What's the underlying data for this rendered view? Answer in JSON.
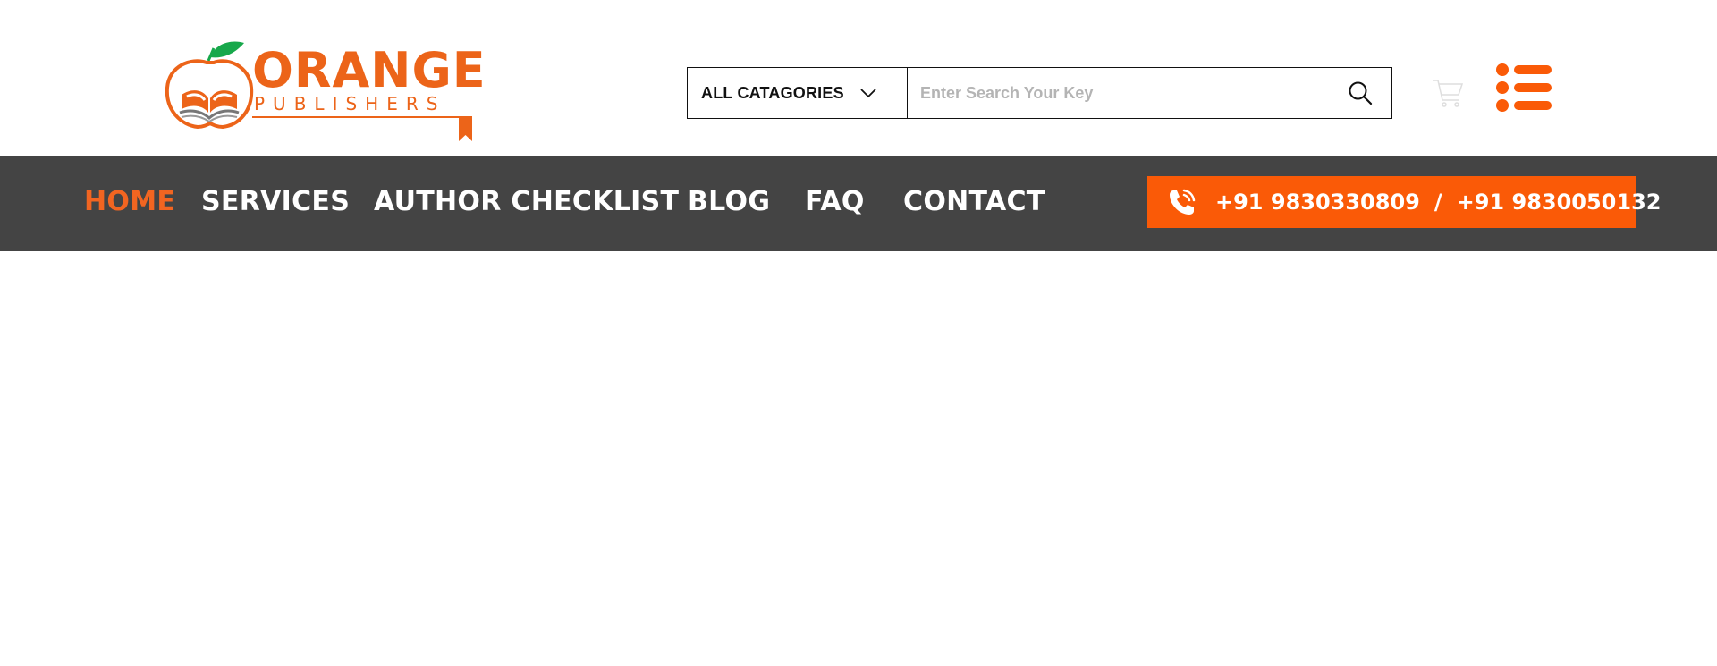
{
  "brand": {
    "name": "ORANGE",
    "tagline": "PUBLISHERS",
    "colors": {
      "orange": "#ec6419",
      "leaf": "#17a84b",
      "nav_bg": "#444444",
      "phone_bg": "#fa5a07"
    }
  },
  "search": {
    "category_label": "ALL CATAGORIES",
    "placeholder": "Enter Search Your Key",
    "value": ""
  },
  "header_icons": {
    "search": "search-icon",
    "cart": "cart-icon",
    "menu": "list-menu-icon",
    "dropdown": "chevron-down-icon"
  },
  "nav": {
    "items": [
      {
        "label": "HOME",
        "active": true
      },
      {
        "label": "SERVICES",
        "active": false
      },
      {
        "label": "AUTHOR CHECKLIST",
        "active": false
      },
      {
        "label": "BLOG",
        "active": false
      },
      {
        "label": "FAQ",
        "active": false
      },
      {
        "label": "CONTACT",
        "active": false
      }
    ]
  },
  "contact": {
    "icon": "phone-call-icon",
    "phone_1": "+91 9830330809",
    "separator": "/",
    "phone_2": "+91 9830050132"
  }
}
